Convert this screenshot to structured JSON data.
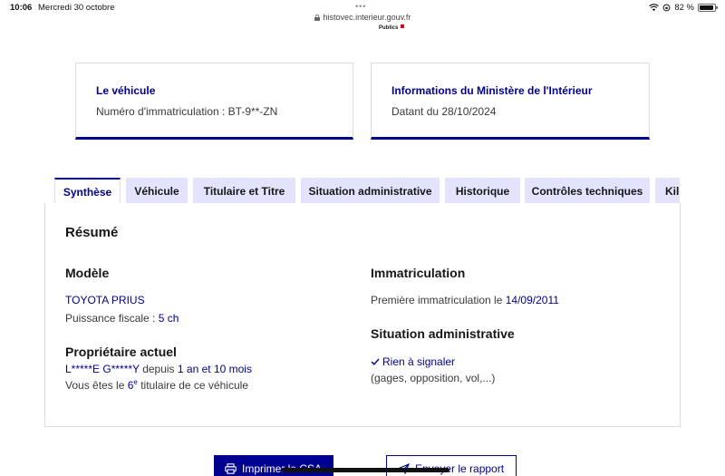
{
  "statusbar": {
    "time": "10:06",
    "date": "Mercredi 30 octobre",
    "dots": "•••",
    "url": "histovec.interieur.gouv.fr",
    "battery": "82 %",
    "battery_level": 0.82
  },
  "header": {
    "logo_fragment": "Publics"
  },
  "vehicle_card": {
    "title": "Le véhicule",
    "value": "Numéro d'immatriculation : BT-9**-ZN"
  },
  "ministry_card": {
    "title": "Informations du Ministère de l'Intérieur",
    "value": "Datant du 28/10/2024"
  },
  "tabs": [
    {
      "label": "Synthèse",
      "active": true
    },
    {
      "label": "Véhicule"
    },
    {
      "label": "Titulaire et Titre"
    },
    {
      "label": "Situation administrative"
    },
    {
      "label": "Historique"
    },
    {
      "label": "Contrôles techniques"
    },
    {
      "label": "Kilo"
    }
  ],
  "summary": {
    "title": "Résumé",
    "model": {
      "heading": "Modèle",
      "name": "TOYOTA PRIUS",
      "power_label": "Puissance fiscale :",
      "power_value": "5 ch"
    },
    "owner": {
      "heading": "Propriétaire actuel",
      "name": "L*****E G*****Y",
      "since_label": "depuis",
      "since_value": "1 an et 10 mois",
      "rank_prefix": "Vous êtes le",
      "rank_number": "6",
      "rank_suffix": "e",
      "rank_rest": "titulaire de ce véhicule"
    },
    "registration": {
      "heading": "Immatriculation",
      "first_label": "Première immatriculation le",
      "first_date": "14/09/2011"
    },
    "admin": {
      "heading": "Situation administrative",
      "status": "Rien à signaler",
      "detail": "(gages, opposition, vol,...)"
    }
  },
  "actions": {
    "print": "Imprimer le CSA",
    "send": "Envoyer le rapport"
  }
}
